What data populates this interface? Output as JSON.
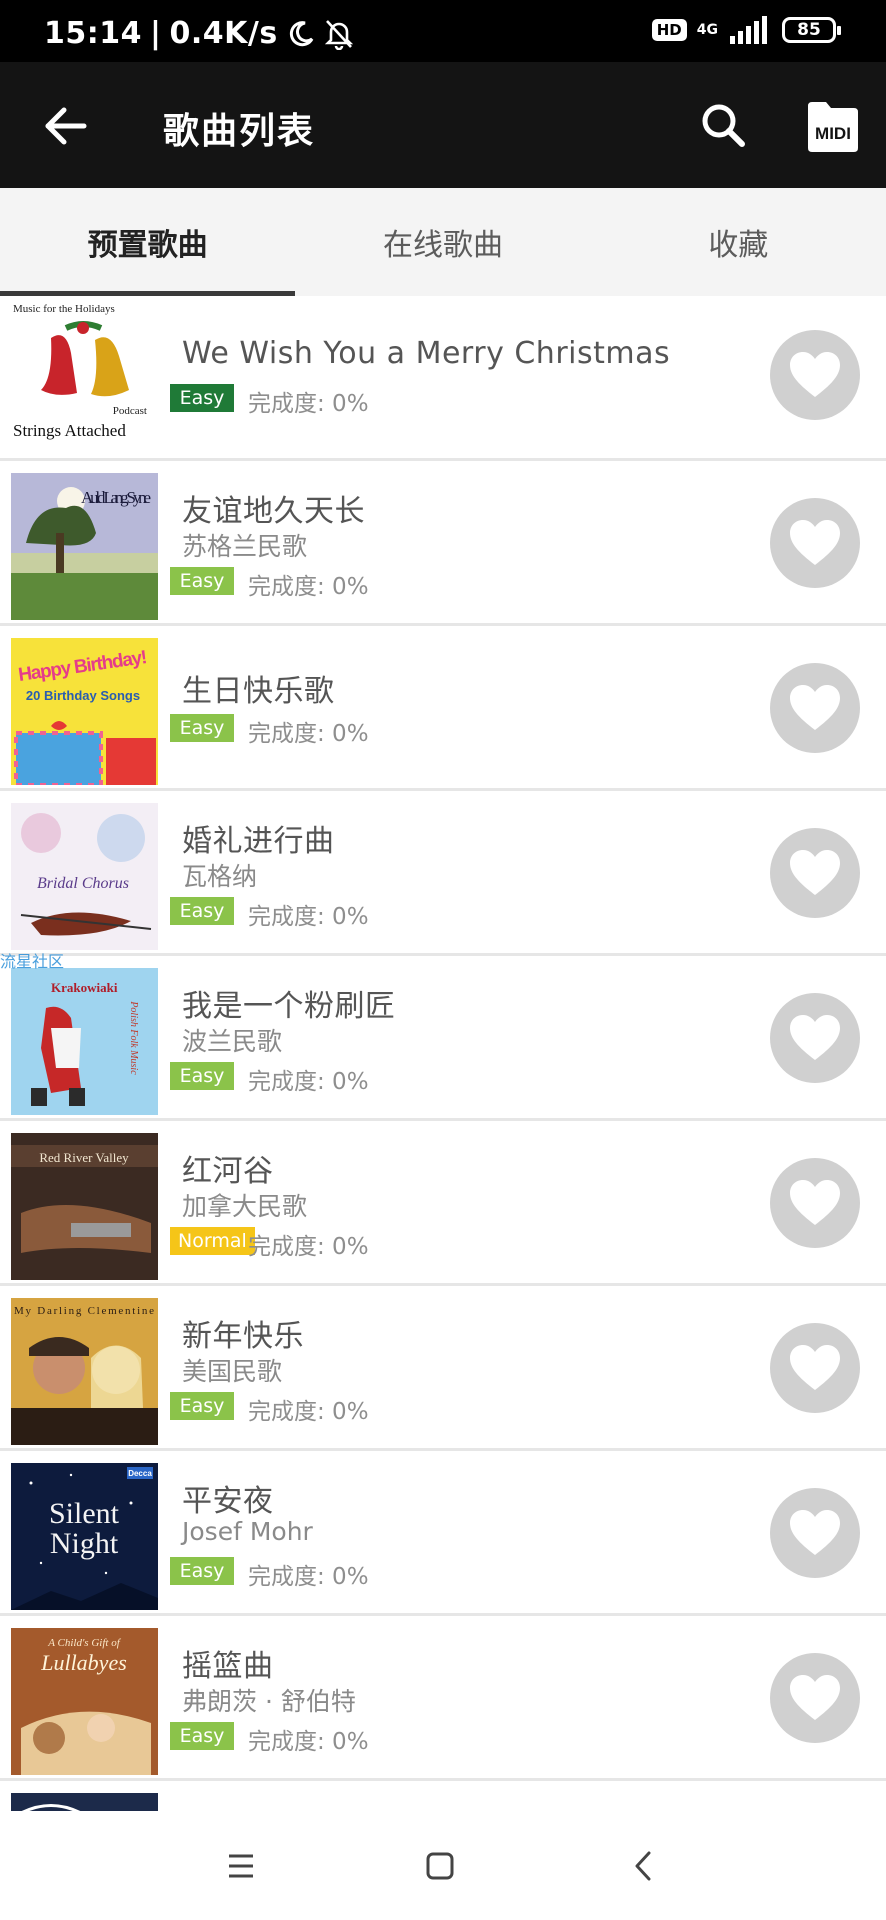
{
  "status_bar": {
    "time": "15:14",
    "separator": "|",
    "net_speed": "0.4K/s",
    "hd_label": "HD",
    "network": "4G",
    "battery": "85",
    "icons": [
      "moon-icon",
      "bell-off-icon",
      "signal-icon",
      "battery-icon"
    ]
  },
  "header": {
    "title": "歌曲列表",
    "midi_label": "MIDI",
    "icons": [
      "back-arrow-icon",
      "search-icon",
      "midi-file-icon"
    ]
  },
  "tabs": [
    {
      "label": "预置歌曲",
      "active": true
    },
    {
      "label": "在线歌曲",
      "active": false
    },
    {
      "label": "收藏",
      "active": false
    }
  ],
  "covers": {
    "christmas": {
      "top": "Music for the Holidays",
      "mid": "Podcast",
      "bottom": "Strings Attached"
    },
    "auld": {
      "text": "Auld Lang Syne"
    },
    "birthday": {
      "line1": "Happy Birthday!",
      "line2": "20 Birthday Songs"
    },
    "bridal": {
      "text": "Bridal Chorus"
    },
    "krakowiaki": {
      "text": "Krakowiaki",
      "side": "Polish Folk Music"
    },
    "redriver": {
      "text": "Red River Valley"
    },
    "clementine": {
      "text": "My Darling Clementine"
    },
    "silent": {
      "line1": "Silent",
      "line2": "Night",
      "label": "Decca"
    },
    "lullabyes": {
      "line1": "A Child's Gift of",
      "line2": "Lullabyes"
    }
  },
  "songs": [
    {
      "title": "We Wish You a Merry Christmas",
      "artist": "",
      "difficulty": "Easy",
      "progress": "完成度: 0%"
    },
    {
      "title": "友谊地久天长",
      "artist": "苏格兰民歌",
      "difficulty": "Easy",
      "progress": "完成度: 0%"
    },
    {
      "title": "生日快乐歌",
      "artist": "",
      "difficulty": "Easy",
      "progress": "完成度: 0%"
    },
    {
      "title": "婚礼进行曲",
      "artist": "瓦格纳",
      "difficulty": "Easy",
      "progress": "完成度: 0%"
    },
    {
      "title": "我是一个粉刷匠",
      "artist": "波兰民歌",
      "difficulty": "Easy",
      "progress": "完成度: 0%"
    },
    {
      "title": "红河谷",
      "artist": "加拿大民歌",
      "difficulty": "Normal",
      "progress": "完成度: 0%"
    },
    {
      "title": "新年快乐",
      "artist": "美国民歌",
      "difficulty": "Easy",
      "progress": "完成度: 0%"
    },
    {
      "title": "平安夜",
      "artist": "Josef Mohr",
      "difficulty": "Easy",
      "progress": "完成度: 0%"
    },
    {
      "title": "摇篮曲",
      "artist": "弗朗茨 · 舒伯特",
      "difficulty": "Easy",
      "progress": "完成度: 0%"
    },
    {
      "title": "",
      "artist": "",
      "difficulty": "",
      "progress": ""
    }
  ],
  "watermark": "流星社区",
  "colors": {
    "easy_dark": "#1f7a37",
    "easy": "#8bc34a",
    "normal": "#f5c518",
    "favorite_bg": "#d0d0d0",
    "app_bar": "#141414",
    "tab_bg": "#f4f4f4"
  },
  "nav": {
    "icons": [
      "menu-icon",
      "home-icon",
      "back-icon"
    ]
  }
}
